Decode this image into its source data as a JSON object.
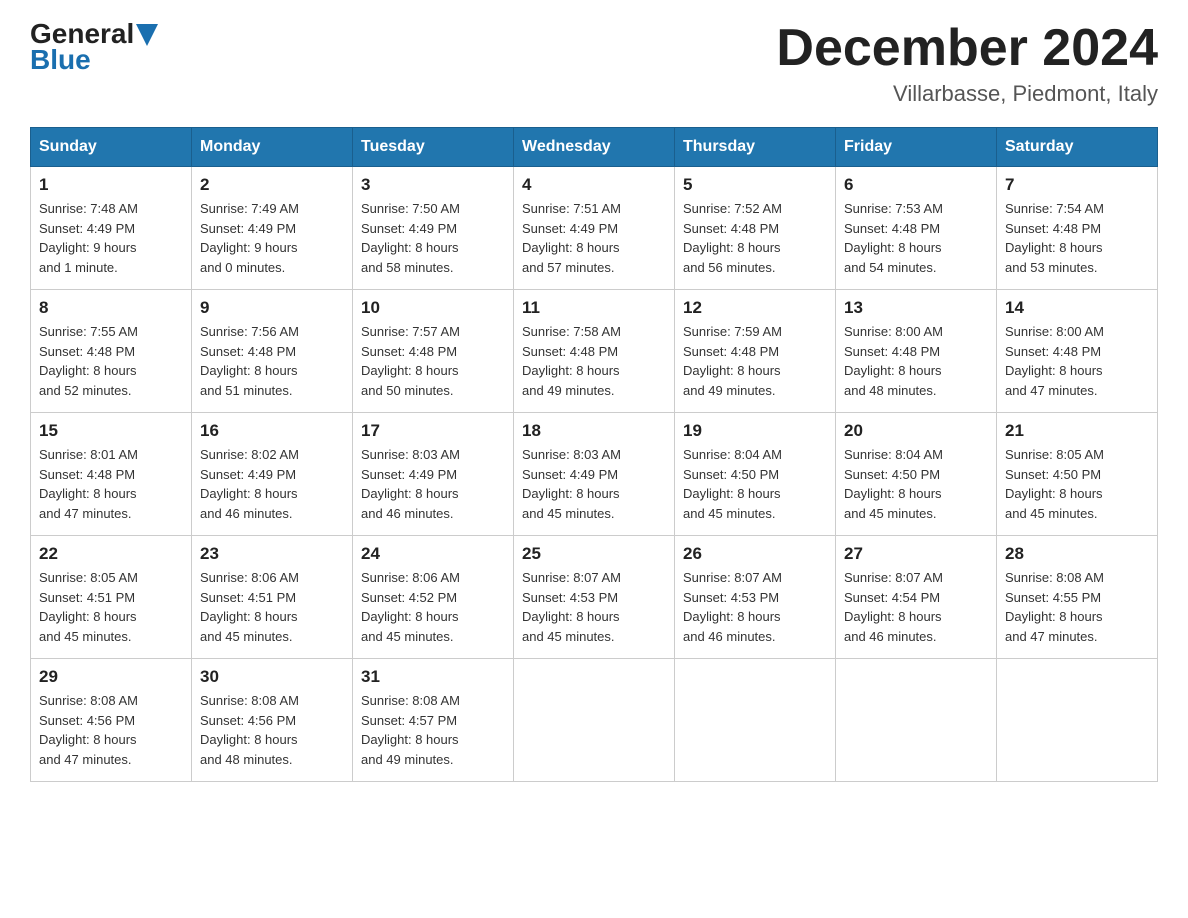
{
  "logo": {
    "line1": "General",
    "arrow_color": "#1a6faf",
    "line2": "Blue"
  },
  "title": "December 2024",
  "subtitle": "Villarbasse, Piedmont, Italy",
  "days_of_week": [
    "Sunday",
    "Monday",
    "Tuesday",
    "Wednesday",
    "Thursday",
    "Friday",
    "Saturday"
  ],
  "weeks": [
    [
      {
        "day": "1",
        "sunrise": "7:48 AM",
        "sunset": "4:49 PM",
        "daylight": "9 hours and 1 minute."
      },
      {
        "day": "2",
        "sunrise": "7:49 AM",
        "sunset": "4:49 PM",
        "daylight": "9 hours and 0 minutes."
      },
      {
        "day": "3",
        "sunrise": "7:50 AM",
        "sunset": "4:49 PM",
        "daylight": "8 hours and 58 minutes."
      },
      {
        "day": "4",
        "sunrise": "7:51 AM",
        "sunset": "4:49 PM",
        "daylight": "8 hours and 57 minutes."
      },
      {
        "day": "5",
        "sunrise": "7:52 AM",
        "sunset": "4:48 PM",
        "daylight": "8 hours and 56 minutes."
      },
      {
        "day": "6",
        "sunrise": "7:53 AM",
        "sunset": "4:48 PM",
        "daylight": "8 hours and 54 minutes."
      },
      {
        "day": "7",
        "sunrise": "7:54 AM",
        "sunset": "4:48 PM",
        "daylight": "8 hours and 53 minutes."
      }
    ],
    [
      {
        "day": "8",
        "sunrise": "7:55 AM",
        "sunset": "4:48 PM",
        "daylight": "8 hours and 52 minutes."
      },
      {
        "day": "9",
        "sunrise": "7:56 AM",
        "sunset": "4:48 PM",
        "daylight": "8 hours and 51 minutes."
      },
      {
        "day": "10",
        "sunrise": "7:57 AM",
        "sunset": "4:48 PM",
        "daylight": "8 hours and 50 minutes."
      },
      {
        "day": "11",
        "sunrise": "7:58 AM",
        "sunset": "4:48 PM",
        "daylight": "8 hours and 49 minutes."
      },
      {
        "day": "12",
        "sunrise": "7:59 AM",
        "sunset": "4:48 PM",
        "daylight": "8 hours and 49 minutes."
      },
      {
        "day": "13",
        "sunrise": "8:00 AM",
        "sunset": "4:48 PM",
        "daylight": "8 hours and 48 minutes."
      },
      {
        "day": "14",
        "sunrise": "8:00 AM",
        "sunset": "4:48 PM",
        "daylight": "8 hours and 47 minutes."
      }
    ],
    [
      {
        "day": "15",
        "sunrise": "8:01 AM",
        "sunset": "4:48 PM",
        "daylight": "8 hours and 47 minutes."
      },
      {
        "day": "16",
        "sunrise": "8:02 AM",
        "sunset": "4:49 PM",
        "daylight": "8 hours and 46 minutes."
      },
      {
        "day": "17",
        "sunrise": "8:03 AM",
        "sunset": "4:49 PM",
        "daylight": "8 hours and 46 minutes."
      },
      {
        "day": "18",
        "sunrise": "8:03 AM",
        "sunset": "4:49 PM",
        "daylight": "8 hours and 45 minutes."
      },
      {
        "day": "19",
        "sunrise": "8:04 AM",
        "sunset": "4:50 PM",
        "daylight": "8 hours and 45 minutes."
      },
      {
        "day": "20",
        "sunrise": "8:04 AM",
        "sunset": "4:50 PM",
        "daylight": "8 hours and 45 minutes."
      },
      {
        "day": "21",
        "sunrise": "8:05 AM",
        "sunset": "4:50 PM",
        "daylight": "8 hours and 45 minutes."
      }
    ],
    [
      {
        "day": "22",
        "sunrise": "8:05 AM",
        "sunset": "4:51 PM",
        "daylight": "8 hours and 45 minutes."
      },
      {
        "day": "23",
        "sunrise": "8:06 AM",
        "sunset": "4:51 PM",
        "daylight": "8 hours and 45 minutes."
      },
      {
        "day": "24",
        "sunrise": "8:06 AM",
        "sunset": "4:52 PM",
        "daylight": "8 hours and 45 minutes."
      },
      {
        "day": "25",
        "sunrise": "8:07 AM",
        "sunset": "4:53 PM",
        "daylight": "8 hours and 45 minutes."
      },
      {
        "day": "26",
        "sunrise": "8:07 AM",
        "sunset": "4:53 PM",
        "daylight": "8 hours and 46 minutes."
      },
      {
        "day": "27",
        "sunrise": "8:07 AM",
        "sunset": "4:54 PM",
        "daylight": "8 hours and 46 minutes."
      },
      {
        "day": "28",
        "sunrise": "8:08 AM",
        "sunset": "4:55 PM",
        "daylight": "8 hours and 47 minutes."
      }
    ],
    [
      {
        "day": "29",
        "sunrise": "8:08 AM",
        "sunset": "4:56 PM",
        "daylight": "8 hours and 47 minutes."
      },
      {
        "day": "30",
        "sunrise": "8:08 AM",
        "sunset": "4:56 PM",
        "daylight": "8 hours and 48 minutes."
      },
      {
        "day": "31",
        "sunrise": "8:08 AM",
        "sunset": "4:57 PM",
        "daylight": "8 hours and 49 minutes."
      },
      null,
      null,
      null,
      null
    ]
  ],
  "labels": {
    "sunrise": "Sunrise:",
    "sunset": "Sunset:",
    "daylight": "Daylight:"
  }
}
